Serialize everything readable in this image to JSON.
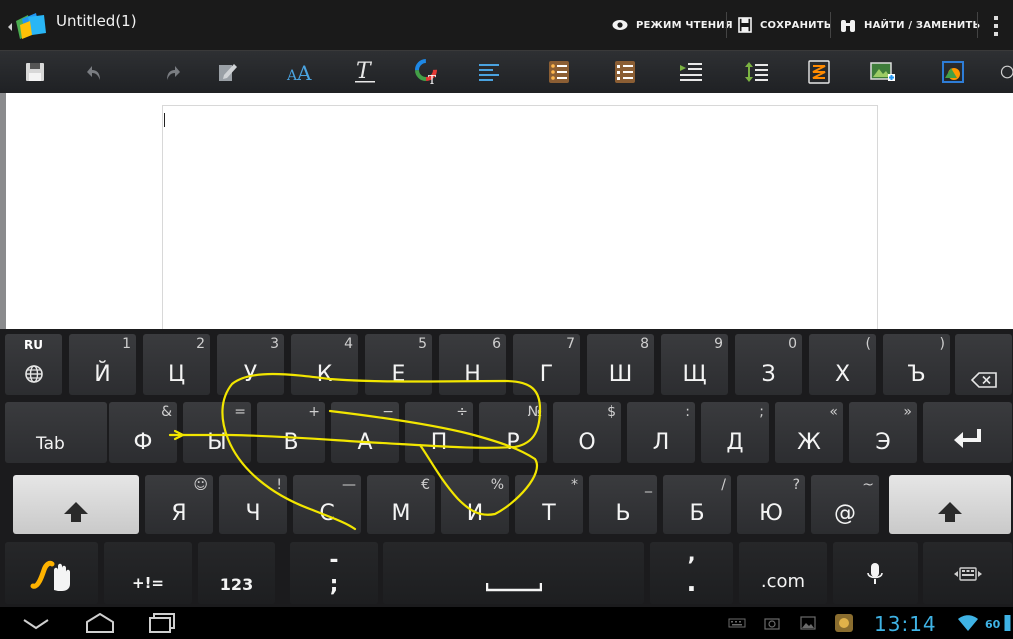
{
  "action_bar": {
    "title": "Untitled(1)",
    "reading_mode_label": "РЕЖИМ ЧТЕНИЯ",
    "save_label": "СОХРАНИТЬ",
    "find_replace_label": "НАЙТИ / ЗАМЕНИТЬ"
  },
  "toolbar_icons": [
    "save-icon",
    "undo-icon",
    "redo-icon",
    "edit-icon",
    "font-size-icon",
    "text-style-icon",
    "text-color-icon",
    "align-icon",
    "bullet-list-icon",
    "numbered-list-icon",
    "indent-icon",
    "line-spacing-icon",
    "page-break-icon",
    "insert-image-icon",
    "insert-shape-icon"
  ],
  "keyboard": {
    "language": "RU",
    "row1": [
      {
        "label": "Й",
        "hint": "1"
      },
      {
        "label": "Ц",
        "hint": "2"
      },
      {
        "label": "У",
        "hint": "3"
      },
      {
        "label": "К",
        "hint": "4"
      },
      {
        "label": "Е",
        "hint": "5"
      },
      {
        "label": "Н",
        "hint": "6"
      },
      {
        "label": "Г",
        "hint": "7"
      },
      {
        "label": "Ш",
        "hint": "8"
      },
      {
        "label": "Щ",
        "hint": "9"
      },
      {
        "label": "З",
        "hint": "0"
      },
      {
        "label": "Х",
        "hint": "("
      },
      {
        "label": "Ъ",
        "hint": ")"
      }
    ],
    "row2": [
      {
        "label": "Ф",
        "hint": "&"
      },
      {
        "label": "Ы",
        "hint": "="
      },
      {
        "label": "В",
        "hint": "+"
      },
      {
        "label": "А",
        "hint": "−"
      },
      {
        "label": "П",
        "hint": "÷"
      },
      {
        "label": "Р",
        "hint": "№"
      },
      {
        "label": "О",
        "hint": "$"
      },
      {
        "label": "Л",
        "hint": ":"
      },
      {
        "label": "Д",
        "hint": ";"
      },
      {
        "label": "Ж",
        "hint": "«"
      },
      {
        "label": "Э",
        "hint": "»"
      }
    ],
    "row3": [
      {
        "label": "Я",
        "hint": "☺"
      },
      {
        "label": "Ч",
        "hint": "!"
      },
      {
        "label": "С",
        "hint": "—"
      },
      {
        "label": "М",
        "hint": "€"
      },
      {
        "label": "И",
        "hint": "%"
      },
      {
        "label": "Т",
        "hint": "*"
      },
      {
        "label": "Ь",
        "hint": "_"
      },
      {
        "label": "Б",
        "hint": "/"
      },
      {
        "label": "Ю",
        "hint": "?"
      },
      {
        "label": "@",
        "hint": "~"
      }
    ],
    "tab_label": "Tab",
    "symbols_label": "+!=",
    "numbers_label": "123",
    "dash_label": "-",
    "semicolon_label": ";",
    "comma_label": "’",
    "period_label": ".",
    "dotcom_label": ".com"
  },
  "status": {
    "clock": "13:14",
    "battery": "60"
  },
  "colors": {
    "swipe_trail": "#f2e600",
    "status_accent": "#3fb3e5",
    "swipe_icon": "#ffb300"
  }
}
